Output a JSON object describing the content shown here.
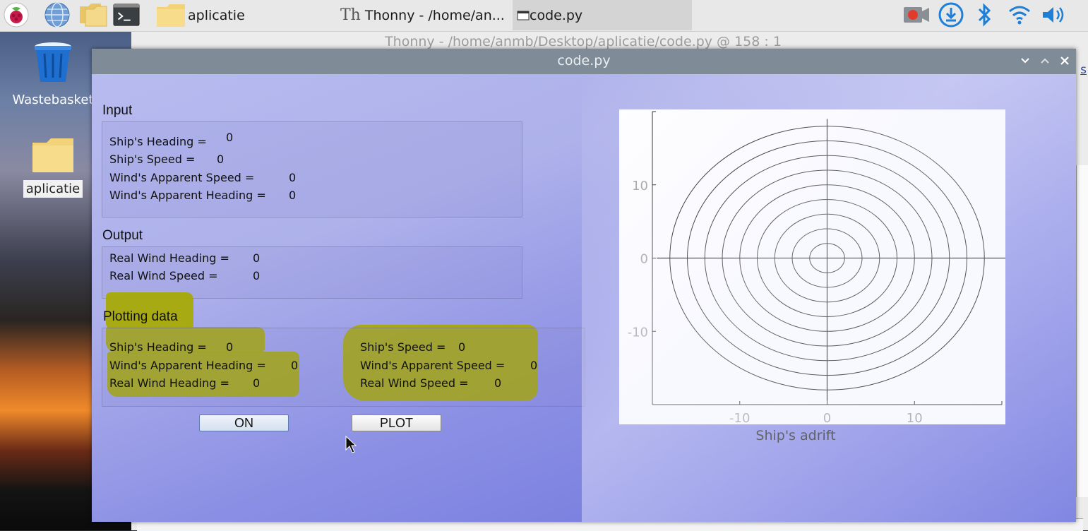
{
  "taskbar": {
    "launchers": [
      "raspberry-menu-icon",
      "web-browser-icon",
      "file-manager-icon",
      "terminal-icon"
    ],
    "tasks": [
      {
        "label": "aplicatie",
        "icon": "folder-icon"
      },
      {
        "label": "Thonny  -  /home/an...",
        "icon": "thonny-icon"
      },
      {
        "label": "code.py",
        "icon": "window-icon"
      }
    ],
    "tray": [
      "record-icon",
      "download-icon",
      "bluetooth-icon",
      "wifi-icon",
      "volume-icon"
    ]
  },
  "desktop": {
    "icons": [
      {
        "label": "Wastebasket"
      },
      {
        "label": "aplicatie"
      }
    ]
  },
  "thonny": {
    "title": "Thonny  -  /home/anmb/Desktop/aplicatie/code.py  @  158 : 1",
    "link_fragment": "s"
  },
  "app": {
    "title": "code.py",
    "input": {
      "title": "Input",
      "fields": [
        {
          "label": "Ship's Heading =",
          "value": "0"
        },
        {
          "label": "Ship's Speed =",
          "value": "0"
        },
        {
          "label": "Wind's Apparent Speed =",
          "value": "0"
        },
        {
          "label": "Wind's Apparent Heading =",
          "value": "0"
        }
      ]
    },
    "output": {
      "title": "Output",
      "fields": [
        {
          "label": "Real Wind Heading =",
          "value": "0"
        },
        {
          "label": "Real Wind Speed =",
          "value": "0"
        }
      ]
    },
    "plotting": {
      "title": "Plotting data",
      "left": [
        {
          "label": "Ship's Heading =",
          "value": "0"
        },
        {
          "label": "Wind's Apparent Heading =",
          "value": "0"
        },
        {
          "label": "Real Wind Heading =",
          "value": "0"
        }
      ],
      "right": [
        {
          "label": "Ship's Speed =",
          "value": "0"
        },
        {
          "label": "Wind's Apparent Speed =",
          "value": "0"
        },
        {
          "label": "Real Wind Speed =",
          "value": "0"
        }
      ]
    },
    "buttons": {
      "on": "ON",
      "plot": "PLOT"
    },
    "highlight_color": "#a7a900"
  },
  "chart_data": {
    "type": "polar-rings",
    "title": "Ship's adrift",
    "xlim": [
      -20,
      20
    ],
    "ylim": [
      -20,
      20
    ],
    "xticks": [
      -10,
      0,
      10
    ],
    "yticks": [
      10,
      0,
      -10
    ],
    "ring_radii": [
      2,
      4,
      6,
      8,
      10,
      12,
      14,
      16,
      18
    ],
    "axes_lines": true,
    "line_color": "#000000"
  }
}
